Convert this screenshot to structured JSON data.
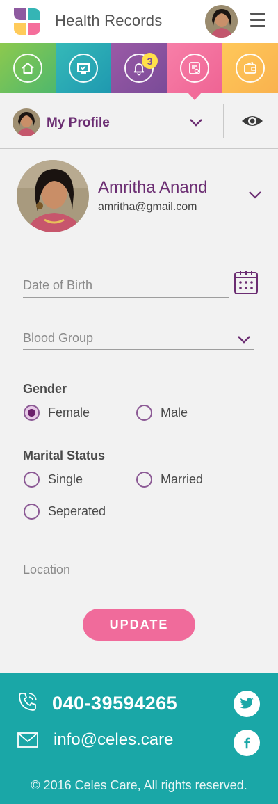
{
  "header": {
    "title": "Health Records"
  },
  "nav": {
    "tabs": [
      {
        "name": "home",
        "icon": "home-icon"
      },
      {
        "name": "records",
        "icon": "monitor-check-icon"
      },
      {
        "name": "notifications",
        "icon": "bell-icon",
        "badge": "3"
      },
      {
        "name": "profile",
        "icon": "profile-card-icon",
        "active": true
      },
      {
        "name": "wallet",
        "icon": "wallet-icon"
      }
    ]
  },
  "profile_selector": {
    "label": "My Profile"
  },
  "user": {
    "name": "Amritha Anand",
    "email": "amritha@gmail.com"
  },
  "form": {
    "dob_placeholder": "Date of Birth",
    "blood_group_placeholder": "Blood Group",
    "gender": {
      "title": "Gender",
      "options": [
        "Female",
        "Male"
      ],
      "selected": "Female"
    },
    "marital_status": {
      "title": "Marital Status",
      "options": [
        "Single",
        "Married",
        "Seperated"
      ],
      "selected": null
    },
    "location_placeholder": "Location",
    "update_label": "UPDATE"
  },
  "footer": {
    "phone": "040-39594265",
    "email": "info@celes.care",
    "copyright": "© 2016 Celes Care, All rights reserved."
  },
  "colors": {
    "primary_purple": "#6b2d72",
    "accent_pink": "#f06b9b",
    "footer_teal": "#1aa7a7"
  }
}
